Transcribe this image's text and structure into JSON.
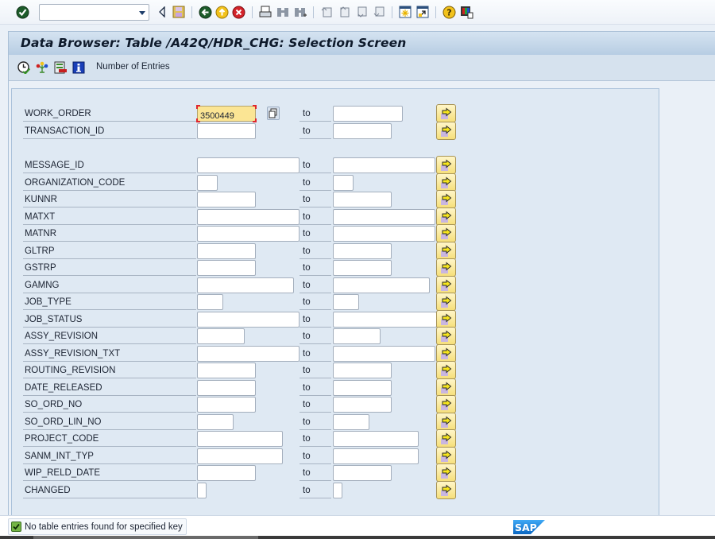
{
  "system_toolbar": {
    "command_field": {
      "value": "",
      "placeholder": ""
    },
    "icons": [
      "enter-icon",
      "back-nav-icon",
      "save-icon",
      "back-icon",
      "exit-icon",
      "cancel-icon",
      "print-icon",
      "find-icon",
      "find-next-icon",
      "first-page-icon",
      "previous-page-icon",
      "next-page-icon",
      "last-page-icon",
      "new-session-icon",
      "shortcut-icon",
      "help-icon",
      "customize-layout-icon"
    ]
  },
  "title": "Data Browser: Table /A42Q/HDR_CHG: Selection Screen",
  "app_toolbar": {
    "icons": [
      "execute-icon",
      "selection-options-icon",
      "delete-row-icon",
      "information-icon"
    ],
    "number_of_entries_label": "Number of Entries"
  },
  "selection": {
    "to_label": "to",
    "fields": [
      {
        "name": "WORK_ORDER",
        "from": "3500449",
        "to": "",
        "focused": true
      },
      {
        "name": "TRANSACTION_ID",
        "from": "",
        "to": ""
      },
      {
        "name": "MESSAGE_ID",
        "from": "",
        "to": ""
      },
      {
        "name": "ORGANIZATION_CODE",
        "from": "",
        "to": ""
      },
      {
        "name": "KUNNR",
        "from": "",
        "to": ""
      },
      {
        "name": "MATXT",
        "from": "",
        "to": ""
      },
      {
        "name": "MATNR",
        "from": "",
        "to": ""
      },
      {
        "name": "GLTRP",
        "from": "",
        "to": ""
      },
      {
        "name": "GSTRP",
        "from": "",
        "to": ""
      },
      {
        "name": "GAMNG",
        "from": "",
        "to": ""
      },
      {
        "name": "JOB_TYPE",
        "from": "",
        "to": ""
      },
      {
        "name": "JOB_STATUS",
        "from": "",
        "to": ""
      },
      {
        "name": "ASSY_REVISION",
        "from": "",
        "to": ""
      },
      {
        "name": "ASSY_REVISION_TXT",
        "from": "",
        "to": ""
      },
      {
        "name": "ROUTING_REVISION",
        "from": "",
        "to": ""
      },
      {
        "name": "DATE_RELEASED",
        "from": "",
        "to": ""
      },
      {
        "name": "SO_ORD_NO",
        "from": "",
        "to": ""
      },
      {
        "name": "SO_ORD_LIN_NO",
        "from": "",
        "to": ""
      },
      {
        "name": "PROJECT_CODE",
        "from": "",
        "to": ""
      },
      {
        "name": "SANM_INT_TYP",
        "from": "",
        "to": ""
      },
      {
        "name": "WIP_RELD_DATE",
        "from": "",
        "to": ""
      },
      {
        "name": "CHANGED",
        "from": "",
        "to": ""
      }
    ]
  },
  "status_bar": {
    "message": "No table entries found for specified key",
    "message_type": "success",
    "logo": "SAP"
  }
}
